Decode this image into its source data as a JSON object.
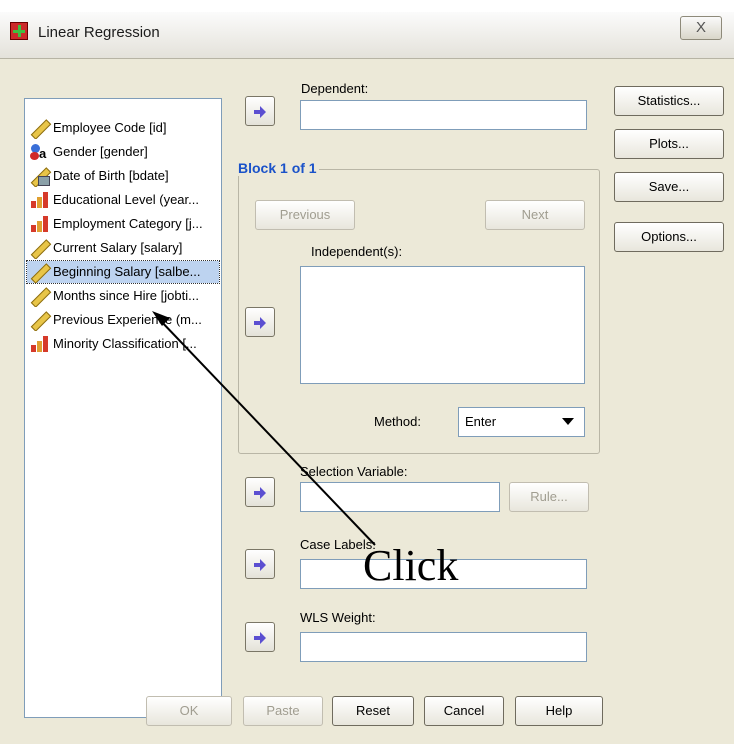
{
  "window": {
    "title": "Linear Regression",
    "close_label": "X"
  },
  "variables": [
    {
      "label": "Employee Code [id]",
      "icon": "ruler-scale-icon"
    },
    {
      "label": "Gender [gender]",
      "icon": "nominal-person-icon"
    },
    {
      "label": "Date of Birth [bdate]",
      "icon": "date-scale-icon"
    },
    {
      "label": "Educational Level (year...",
      "icon": "ordinal-bars-icon"
    },
    {
      "label": "Employment Category [j...",
      "icon": "ordinal-bars-icon"
    },
    {
      "label": "Current Salary [salary]",
      "icon": "ruler-scale-icon"
    },
    {
      "label": "Beginning Salary [salbe...",
      "icon": "ruler-scale-icon",
      "selected": true
    },
    {
      "label": "Months since Hire [jobti...",
      "icon": "ruler-scale-icon"
    },
    {
      "label": "Previous Experience (m...",
      "icon": "ruler-scale-icon"
    },
    {
      "label": "Minority Classification [...",
      "icon": "ordinal-bars-icon"
    }
  ],
  "dependent": {
    "label": "Dependent:",
    "value": ""
  },
  "block": {
    "title": "Block 1 of 1",
    "previous_label": "Previous",
    "next_label": "Next"
  },
  "independents": {
    "label": "Independent(s):"
  },
  "method": {
    "label": "Method:",
    "value": "Enter"
  },
  "selection_variable": {
    "label": "Selection Variable:",
    "value": "",
    "rule_label": "Rule..."
  },
  "case_labels": {
    "label": "Case Labels:",
    "value": ""
  },
  "wls_weight": {
    "label": "WLS Weight:",
    "value": ""
  },
  "side_buttons": {
    "statistics": "Statistics...",
    "plots": "Plots...",
    "save": "Save...",
    "options": "Options..."
  },
  "bottom_buttons": {
    "ok": "OK",
    "paste": "Paste",
    "reset": "Reset",
    "cancel": "Cancel",
    "help": "Help"
  },
  "annotation": {
    "text": "Click"
  },
  "colors": {
    "selection": "#bdd3f0",
    "block_title": "#1a52c9",
    "arrow": "#5b4fd1",
    "dialog_bg": "#ece9d8"
  }
}
